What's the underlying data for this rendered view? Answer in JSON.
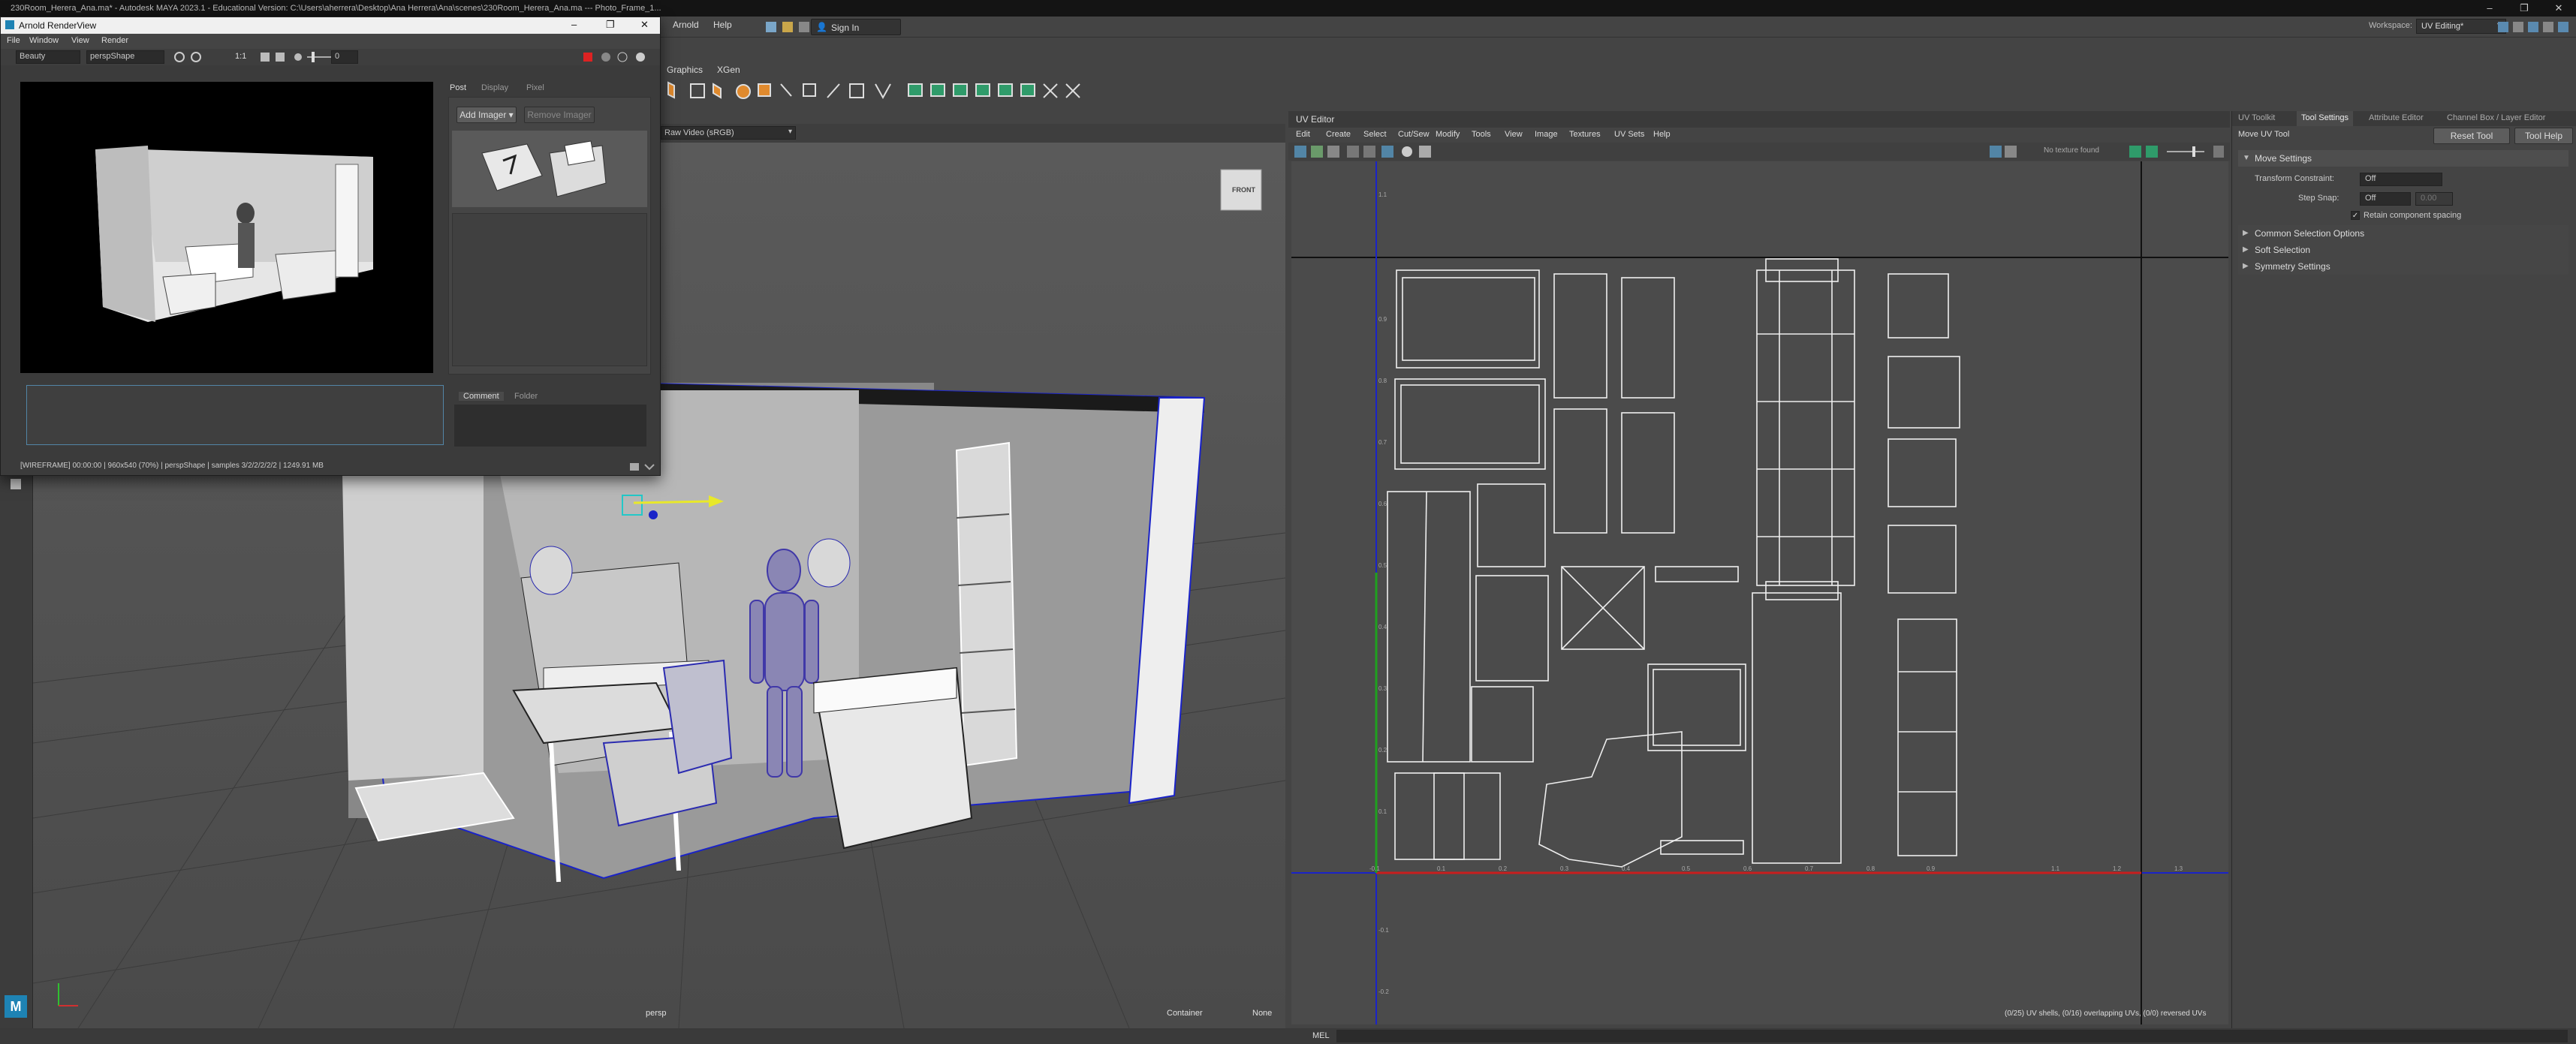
{
  "app": {
    "title": "230Room_Herera_Ana.ma* - Autodesk MAYA 2023.1 - Educational Version: C:\\Users\\aherrera\\Desktop\\Ana Herrera\\Ana\\scenes\\230Room_Herera_Ana.ma   ---  Photo_Frame_1...",
    "window_buttons": [
      "–",
      "❐",
      "✕"
    ]
  },
  "menubar": {
    "items": [
      "Arnold",
      "Help"
    ],
    "sign_in": "Sign In",
    "workspace_label": "Workspace:",
    "workspace_value": "UV Editing*"
  },
  "shelf": {
    "tabs": [
      "Graphics",
      "XGen"
    ]
  },
  "viewport": {
    "color_space": "Raw Video (sRGB)",
    "camera_label": "persp",
    "container_label": "Container",
    "none_label": "None",
    "viewcube_label": "FRONT"
  },
  "arnold": {
    "title": "Arnold RenderView",
    "menu": [
      "File",
      "Window",
      "View",
      "Render"
    ],
    "aov": "Beauty",
    "camera": "perspShape",
    "ratio": "1:1",
    "exposure": "0",
    "side_tabs": [
      "Post",
      "Display",
      "Pixel"
    ],
    "add_imager": "Add Imager",
    "remove_imager": "Remove Imager",
    "comment_tabs": [
      "Comment",
      "Folder"
    ],
    "status": "[WIREFRAME]    00:00:00 | 960x540 (70%) | perspShape | samples 3/2/2/2/2/2 | 1249.91 MB"
  },
  "uv_editor": {
    "title": "UV Editor",
    "menu": [
      "Edit",
      "Create",
      "Select",
      "Cut/Sew",
      "Modify",
      "Tools",
      "View",
      "Image",
      "Textures",
      "UV Sets",
      "Help"
    ],
    "texture_status": "No texture found",
    "stats": "(0/25) UV shells, (0/16) overlapping UVs, (0/0) reversed UVs",
    "u_ticks": [
      "-0.1",
      "0.1",
      "0.2",
      "0.3",
      "0.4",
      "0.5",
      "0.6",
      "0.7",
      "0.8",
      "0.9",
      "1.1",
      "1.2",
      "1.3"
    ],
    "v_ticks": [
      "1.1",
      "0.9",
      "0.8",
      "0.7",
      "0.6",
      "0.5",
      "0.4",
      "0.3",
      "0.2",
      "0.1",
      "-0.1",
      "-0.2"
    ]
  },
  "right_panel": {
    "tabs": [
      "UV Toolkit",
      "Tool Settings",
      "Attribute Editor",
      "Channel Box / Layer Editor"
    ],
    "tool_name": "Move UV Tool",
    "reset_tool": "Reset Tool",
    "tool_help": "Tool Help",
    "sections": [
      "Move Settings",
      "Common Selection Options",
      "Soft Selection",
      "Symmetry Settings"
    ],
    "transform_constraint_label": "Transform Constraint:",
    "transform_constraint_value": "Off",
    "step_snap_label": "Step Snap:",
    "step_snap_value": "Off",
    "step_snap_amount": "0.00",
    "retain_label": "Retain component spacing"
  },
  "statusbar": {
    "mel": "MEL"
  },
  "colors": {
    "accent": "#5285a6",
    "selected_blue": "#1a23c8",
    "uv_red_axis": "#c81e1e",
    "uv_green_axis": "#1fa01f"
  }
}
